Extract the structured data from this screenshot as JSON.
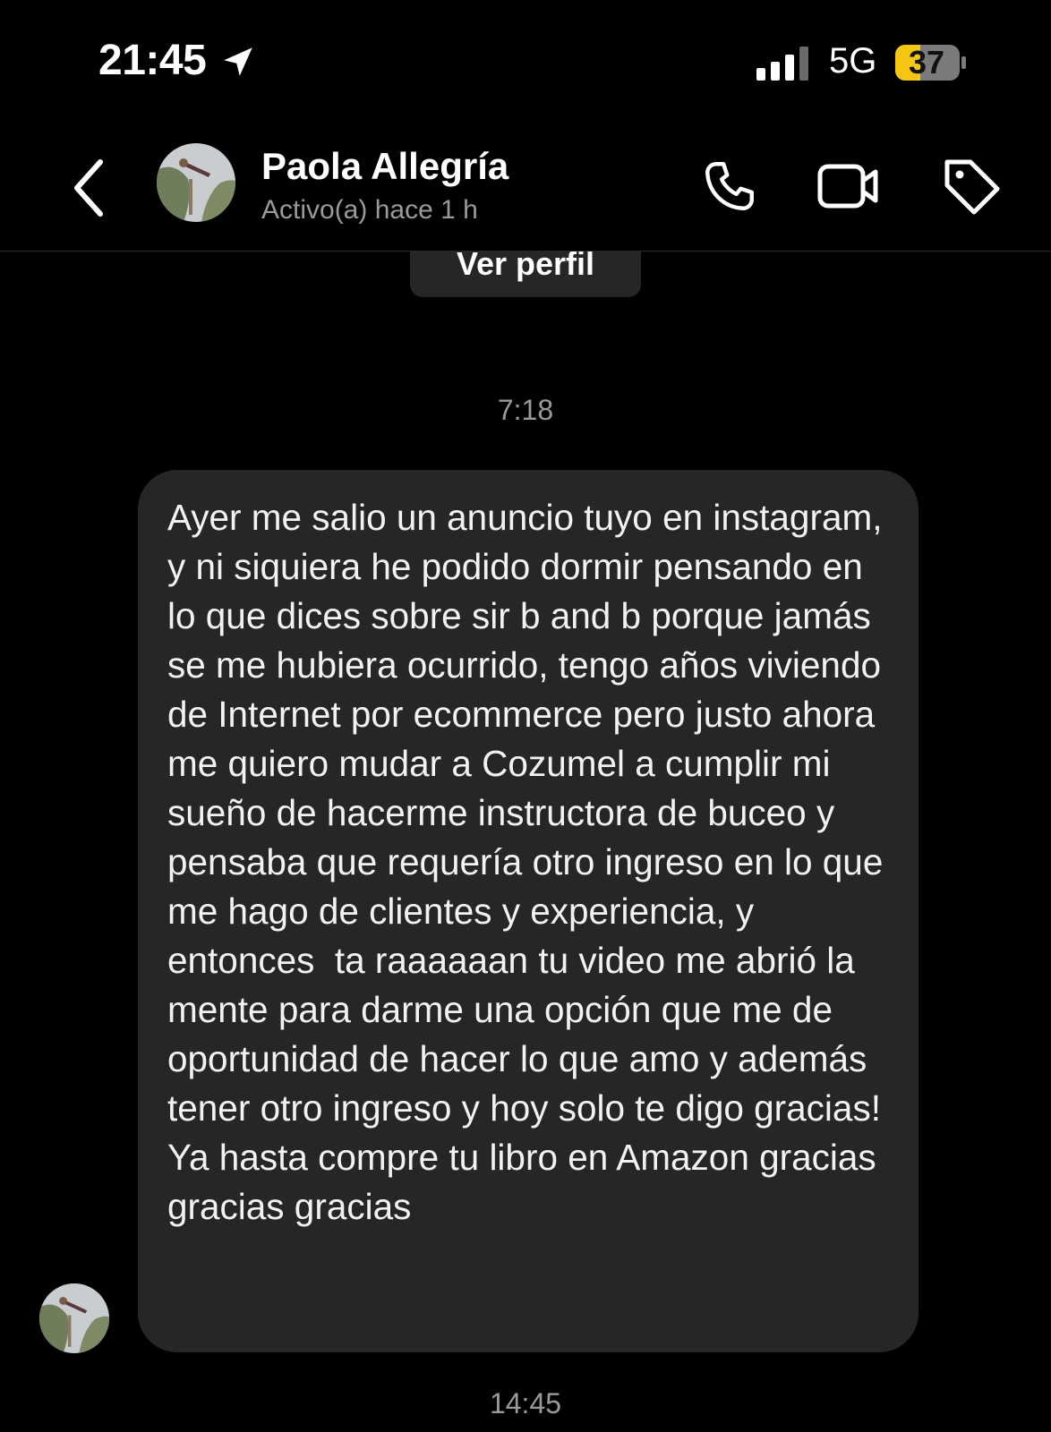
{
  "status_bar": {
    "time": "21:45",
    "network": "5G",
    "battery": "37",
    "battery_color": "#f6c615"
  },
  "header": {
    "contact_name": "Paola Allegría",
    "contact_status": "Activo(a) hace 1 h",
    "icons": [
      "back-chevron-icon",
      "phone-icon",
      "video-camera-icon",
      "tag-icon"
    ]
  },
  "profile_button": {
    "label": "Ver perfil"
  },
  "messages": {
    "timestamp_1": "7:18",
    "message_text": "Ayer me salio un anuncio tuyo en instagram, y ni siquiera he podido dormir pensando en lo que dices sobre sir b and b porque jamás se me hubiera ocurrido, tengo años viviendo de Internet por ecommerce pero justo ahora me quiero mudar a Cozumel a cumplir mi sueño de hacerme instructora de buceo y pensaba que requería otro ingreso en lo que me hago de clientes y experiencia, y entonces  ta raaaaaan tu video me abrió la mente para darme una opción que me de oportunidad de hacer lo que amo y además tener otro ingreso y hoy solo te digo gracias! Ya hasta compre tu libro en Amazon gracias gracias gracias",
    "timestamp_2": "14:45"
  }
}
